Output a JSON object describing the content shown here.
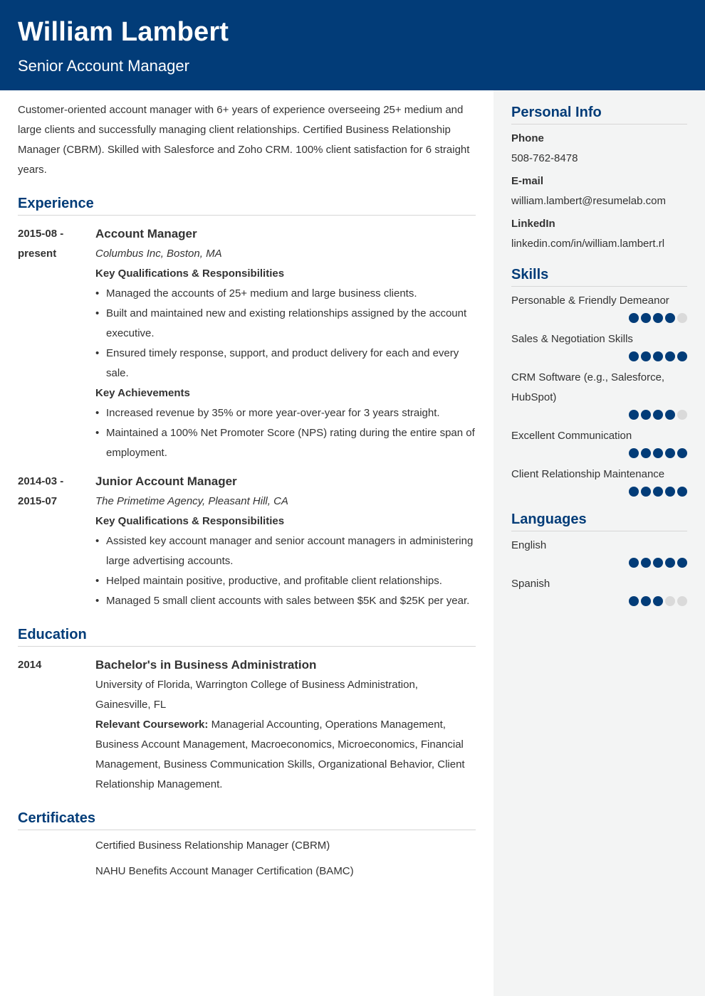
{
  "header": {
    "name": "William Lambert",
    "title": "Senior Account Manager"
  },
  "colors": {
    "accent": "#023c78",
    "sidebar_bg": "#f3f4f4",
    "text": "#333333",
    "dot_empty": "#dadada"
  },
  "summary": "Customer-oriented account manager with 6+ years of experience overseeing 25+ medium and large clients and successfully managing client relationships. Certified Business Relationship Manager (CBRM). Skilled with Salesforce and Zoho CRM. 100% client satisfaction for 6 straight years.",
  "experience": {
    "title": "Experience",
    "entries": [
      {
        "date_start": "2015-08 -",
        "date_end": "present",
        "role": "Account Manager",
        "company": "Columbus Inc, Boston, MA",
        "qual_heading": "Key Qualifications & Responsibilities",
        "qualifications": [
          "Managed the accounts of 25+ medium and large business clients.",
          "Built and maintained new and existing relationships assigned by the account executive.",
          "Ensured timely response, support, and product delivery for each and every sale."
        ],
        "ach_heading": "Key Achievements",
        "achievements": [
          "Increased revenue by 35% or more year-over-year for 3 years straight.",
          "Maintained a 100% Net Promoter Score (NPS) rating during the entire span of employment."
        ]
      },
      {
        "date_start": "2014-03 -",
        "date_end": "2015-07",
        "role": "Junior Account Manager",
        "company": "The Primetime Agency, Pleasant Hill, CA",
        "qual_heading": "Key Qualifications & Responsibilities",
        "qualifications": [
          "Assisted key account manager and senior account managers in administering large advertising accounts.",
          "Helped maintain positive, productive, and profitable client relationships.",
          "Managed 5 small client accounts with sales between $5K and $25K per year."
        ]
      }
    ]
  },
  "education": {
    "title": "Education",
    "entries": [
      {
        "date": "2014",
        "degree": "Bachelor's in Business Administration",
        "school": "University of Florida, Warrington College of Business Administration, Gainesville, FL",
        "coursework_label": "Relevant Coursework:",
        "coursework": "Managerial Accounting, Operations Management, Business Account Management, Macroeconomics, Microeconomics, Financial Management, Business Communication Skills, Organizational Behavior, Client Relationship Management."
      }
    ]
  },
  "certificates": {
    "title": "Certificates",
    "items": [
      "Certified Business Relationship Manager (CBRM)",
      "NAHU Benefits Account Manager Certification (BAMC)"
    ]
  },
  "personal_info": {
    "title": "Personal Info",
    "phone_label": "Phone",
    "phone": "508-762-8478",
    "email_label": "E-mail",
    "email": "william.lambert@resumelab.com",
    "linkedin_label": "LinkedIn",
    "linkedin": "linkedin.com/in/william.lambert.rl"
  },
  "skills": {
    "title": "Skills",
    "max_level": 5,
    "items": [
      {
        "name": "Personable & Friendly Demeanor",
        "level": 4
      },
      {
        "name": "Sales & Negotiation Skills",
        "level": 5
      },
      {
        "name": "CRM Software (e.g., Salesforce, HubSpot)",
        "level": 4
      },
      {
        "name": "Excellent Communication",
        "level": 5
      },
      {
        "name": "Client Relationship Maintenance",
        "level": 5
      }
    ]
  },
  "languages": {
    "title": "Languages",
    "max_level": 5,
    "items": [
      {
        "name": "English",
        "level": 5
      },
      {
        "name": "Spanish",
        "level": 3
      }
    ]
  }
}
